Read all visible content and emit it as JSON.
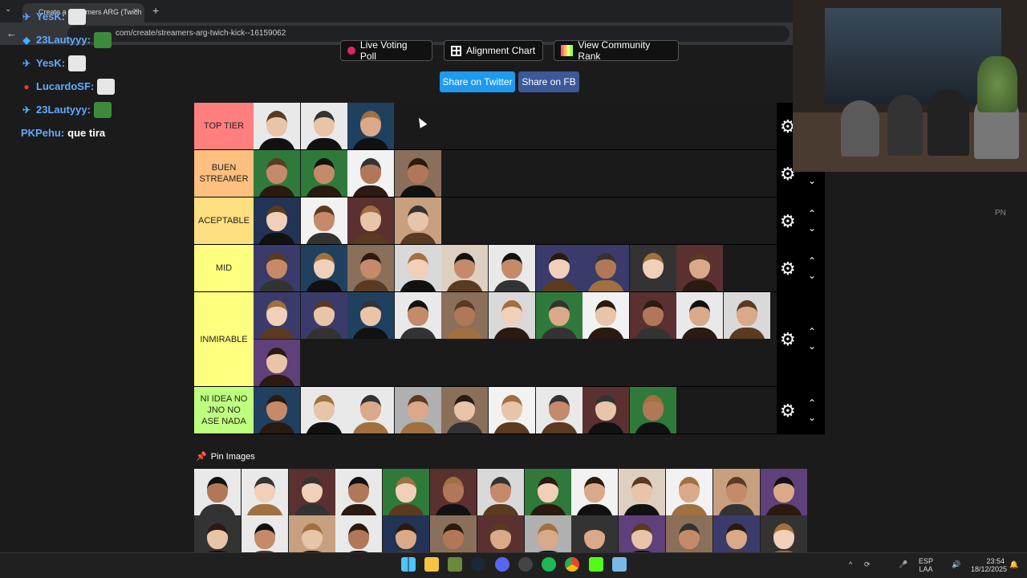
{
  "browser": {
    "tab_title": "Create a Streamers ARG (Twich",
    "tab_close": "×",
    "new_tab": "+",
    "address": "com/create/streamers-arg-twich-kick--16159062"
  },
  "chat": [
    {
      "user": "YesK:",
      "msg": "",
      "badge_color": "#5aa0ff",
      "emote": "#e6e6e6"
    },
    {
      "user": "23Lautyyy:",
      "msg": "",
      "badge_color": "#39b3ff",
      "emote": "#3d8a3d"
    },
    {
      "user": "YesK:",
      "msg": "",
      "badge_color": "#5aa0ff",
      "emote": "#e6e6e6"
    },
    {
      "user": "LucardoSF:",
      "msg": "",
      "badge_color": "#e04020",
      "emote": "#e6e6e6"
    },
    {
      "user": "23Lautyyy:",
      "msg": "",
      "badge_color": "#39b3ff",
      "emote": "#3d8a3d"
    },
    {
      "user": "PKPehu:",
      "msg": "que tira",
      "badge_color": "",
      "emote": ""
    }
  ],
  "buttons": {
    "live_voting": "Live Voting Poll",
    "alignment": "Alignment Chart",
    "community": "View Community Rank",
    "share_twitter": "Share on Twitter",
    "share_fb": "Share on FB"
  },
  "tiers": [
    {
      "label": "TOP TIER",
      "color": "#ff7f7f",
      "count": 3,
      "rows": 1
    },
    {
      "label": "BUEN STREAMER",
      "color": "#ffbf7f",
      "count": 4,
      "rows": 1
    },
    {
      "label": "ACEPTABLE",
      "color": "#ffdf7f",
      "count": 4,
      "rows": 1
    },
    {
      "label": "MID",
      "color": "#ffff7f",
      "count": 10,
      "rows": 1
    },
    {
      "label": "INMIRABLE",
      "color": "#ffff7f",
      "count": 12,
      "rows": 2
    },
    {
      "label": "NI IDEA NO JNO NO ASE NADA",
      "color": "#bfff7f",
      "count": 9,
      "rows": 1
    }
  ],
  "pin": {
    "label": "Pin Images"
  },
  "pool": {
    "count": 26
  },
  "side_text": "PN",
  "tray": {
    "lang1": "ESP",
    "lang2": "LAA",
    "time": "23:54",
    "date": "18/12/2025"
  },
  "icons": {
    "gear": "gear-icon",
    "up": "chevron-up-icon",
    "down": "chevron-down-icon"
  }
}
